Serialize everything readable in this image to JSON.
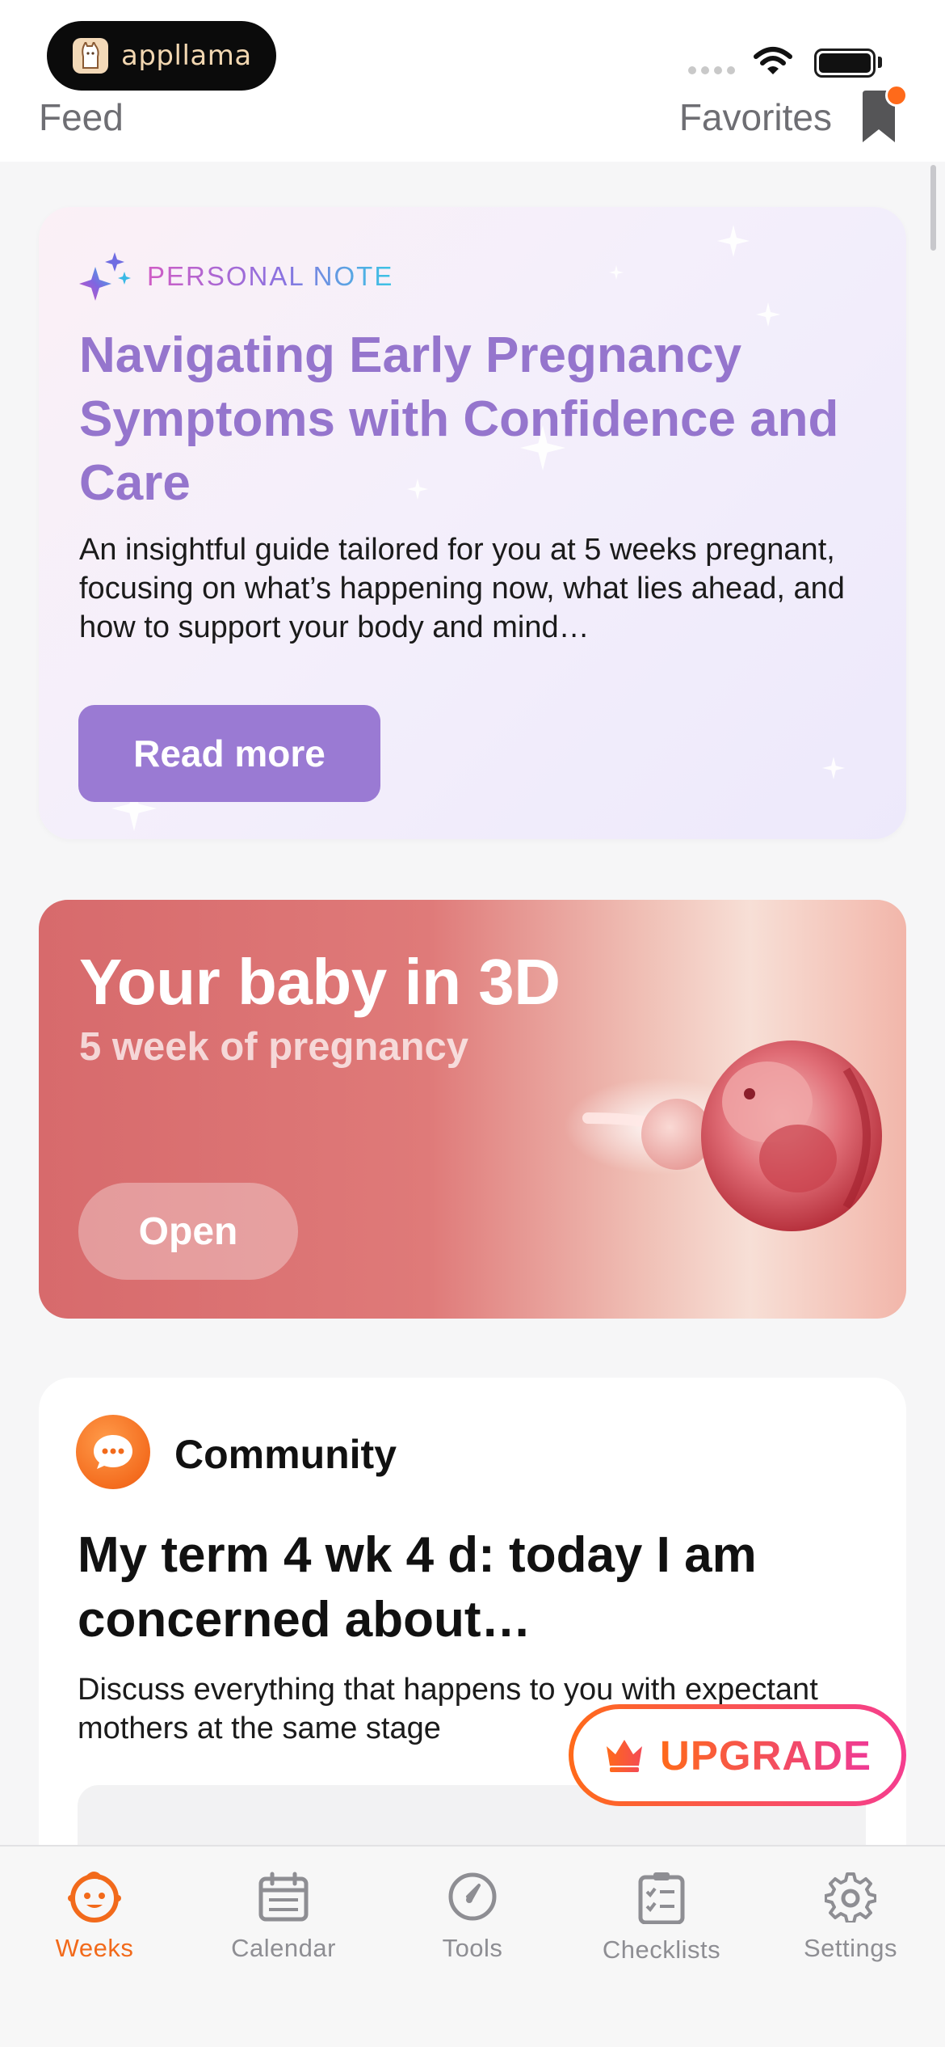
{
  "status_bar": {
    "app_pill_name": "appllama"
  },
  "header": {
    "feed_label": "Feed",
    "favorites_label": "Favorites"
  },
  "personal_note": {
    "tag": "PERSONAL NOTE",
    "title": "Navigating Early Pregnancy Symptoms with Confidence and Care",
    "description": "An insightful guide tailored for you at 5 weeks pregnant, focusing on what’s happening now, what lies ahead, and how to support your body and mind…",
    "button_label": "Read more"
  },
  "baby_3d": {
    "title": "Your baby in 3D",
    "subtitle": "5 week of pregnancy",
    "button_label": "Open"
  },
  "community": {
    "label": "Community",
    "title": "My term 4 wk 4 d: today I am concerned about…",
    "description": "Discuss everything that happens to you with expectant mothers at the same stage"
  },
  "upgrade": {
    "label": "UPGRADE"
  },
  "tabbar": {
    "items": [
      {
        "label": "Weeks",
        "icon": "baby-face-icon",
        "active": true
      },
      {
        "label": "Calendar",
        "icon": "calendar-icon",
        "active": false
      },
      {
        "label": "Tools",
        "icon": "gauge-icon",
        "active": false
      },
      {
        "label": "Checklists",
        "icon": "checklist-icon",
        "active": false
      },
      {
        "label": "Settings",
        "icon": "gear-icon",
        "active": false
      }
    ]
  },
  "colors": {
    "accent": "#f26a1b",
    "note_title": "#9575cd",
    "read_more_button": "#9a7ad3",
    "baby_card": "#d76a6c"
  }
}
